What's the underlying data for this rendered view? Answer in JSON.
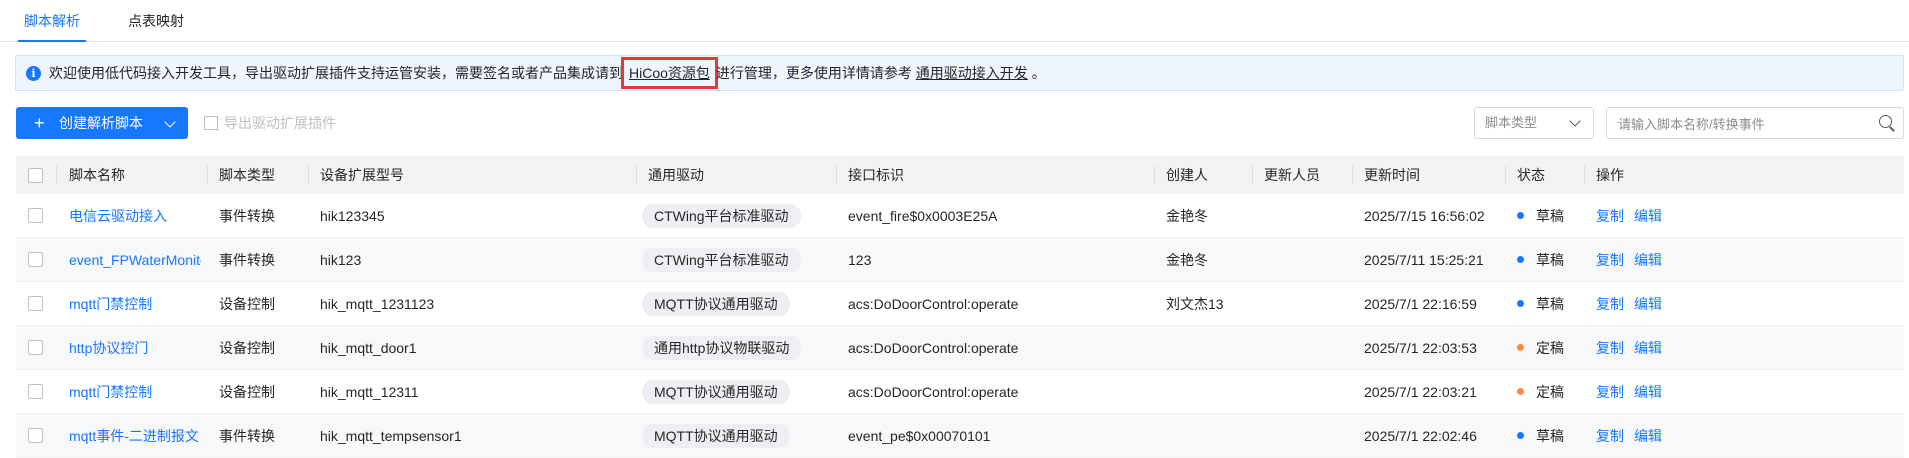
{
  "tabs": [
    {
      "label": "脚本解析",
      "active": true
    },
    {
      "label": "点表映射",
      "active": false
    }
  ],
  "banner": {
    "icon": "info-icon",
    "text_before": "欢迎使用低代码接入开发工具，导出驱动扩展插件支持运管安装，需要签名或者产品集成请到",
    "link_resource": "HiCoo资源包",
    "text_middle": "进行管理，更多使用详情请参考",
    "link_guide": "通用驱动接入开发",
    "text_end": "。"
  },
  "toolbar": {
    "create_label": "创建解析脚本",
    "export_label": "导出驱动扩展插件",
    "type_select_placeholder": "脚本类型",
    "search_placeholder": "请输入脚本名称/转换事件"
  },
  "table": {
    "columns": [
      "脚本名称",
      "脚本类型",
      "设备扩展型号",
      "通用驱动",
      "接口标识",
      "创建人",
      "更新人员",
      "更新时间",
      "状态",
      "操作"
    ],
    "rows": [
      {
        "name": "电信云驱动接入",
        "type": "事件转换",
        "model": "hik123345",
        "driver": "CTWing平台标准驱动",
        "interface": "event_fire$0x0003E25A",
        "creator": "金艳冬",
        "updater": "",
        "updated": "2025/7/15 16:56:02",
        "status": "草稿",
        "status_color": "#1677ff"
      },
      {
        "name": "event_FPWaterMonitor",
        "type": "事件转换",
        "model": "hik123",
        "driver": "CTWing平台标准驱动",
        "interface": "123",
        "creator": "金艳冬",
        "updater": "",
        "updated": "2025/7/11 15:25:21",
        "status": "草稿",
        "status_color": "#1677ff"
      },
      {
        "name": "mqtt门禁控制",
        "type": "设备控制",
        "model": "hik_mqtt_1231123",
        "driver": "MQTT协议通用驱动",
        "interface": "acs:DoDoorControl:operate",
        "creator": "刘文杰13",
        "updater": "",
        "updated": "2025/7/1 22:16:59",
        "status": "草稿",
        "status_color": "#1677ff"
      },
      {
        "name": "http协议控门",
        "type": "设备控制",
        "model": "hik_mqtt_door1",
        "driver": "通用http协议物联驱动",
        "interface": "acs:DoDoorControl:operate",
        "creator": "",
        "updater": "",
        "updated": "2025/7/1 22:03:53",
        "status": "定稿",
        "status_color": "#fa8c3c"
      },
      {
        "name": "mqtt门禁控制",
        "type": "设备控制",
        "model": "hik_mqtt_12311",
        "driver": "MQTT协议通用驱动",
        "interface": "acs:DoDoorControl:operate",
        "creator": "",
        "updater": "",
        "updated": "2025/7/1 22:03:21",
        "status": "定稿",
        "status_color": "#fa8c3c"
      },
      {
        "name": "mqtt事件-二进制报文",
        "type": "事件转换",
        "model": "hik_mqtt_tempsensor1",
        "driver": "MQTT协议通用驱动",
        "interface": "event_pe$0x00070101",
        "creator": "",
        "updater": "",
        "updated": "2025/7/1 22:02:46",
        "status": "草稿",
        "status_color": "#1677ff"
      }
    ],
    "actions": [
      "复制",
      "编辑"
    ]
  }
}
